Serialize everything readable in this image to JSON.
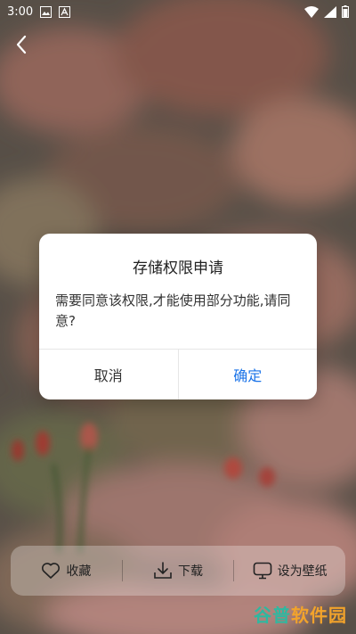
{
  "status_bar": {
    "time": "3:00"
  },
  "dialog": {
    "title": "存储权限申请",
    "message": "需要同意该权限,才能使用部分功能,请同意?",
    "cancel_label": "取消",
    "confirm_label": "确定"
  },
  "toolbar": {
    "favorite_label": "收藏",
    "download_label": "下载",
    "set_wallpaper_label": "设为壁纸"
  },
  "watermark": {
    "part1": "谷普",
    "part2": "软件园"
  },
  "colors": {
    "accent": "#1a73e8"
  }
}
